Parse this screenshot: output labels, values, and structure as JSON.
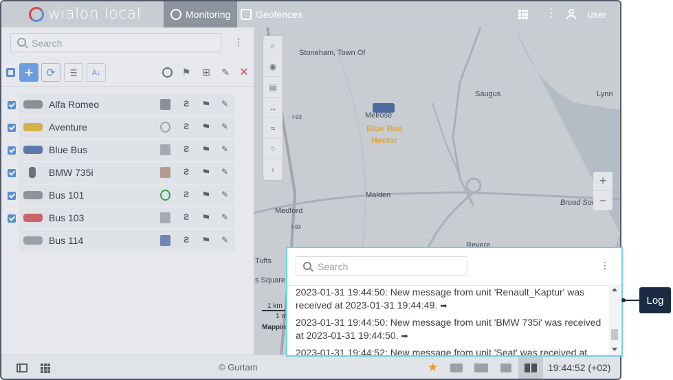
{
  "app": {
    "logo_text": "wialon local",
    "user": "user",
    "tabs": [
      {
        "label": "Monitoring",
        "active": true
      },
      {
        "label": "Geofences",
        "active": false
      }
    ]
  },
  "units_panel": {
    "search_placeholder": "Search",
    "units": [
      {
        "name": "Alfa Romeo",
        "checked": true,
        "driver": "photo"
      },
      {
        "name": "Aventure",
        "checked": true,
        "driver": "wheel"
      },
      {
        "name": "Blue Bus",
        "checked": true,
        "driver": "photo"
      },
      {
        "name": "BMW 735i",
        "checked": true,
        "driver": "photo"
      },
      {
        "name": "Bus 101",
        "checked": true,
        "driver": "wheel-green"
      },
      {
        "name": "Bus 103",
        "checked": true,
        "driver": "photo"
      },
      {
        "name": "Bus 114",
        "checked": false,
        "driver": "photo"
      }
    ]
  },
  "map": {
    "labels": [
      "Stoneham, Town Of",
      "Melrose",
      "Saugus",
      "Lynn",
      "Malden",
      "Medford",
      "Broad Sou",
      "Revere",
      "Tufts",
      "s Square",
      "I-93",
      "I-93",
      "Mapping"
    ],
    "unit_labels": [
      "Blue Bus",
      "Hector"
    ],
    "scale_km": "1 km",
    "scale_mi": "1 mi"
  },
  "log": {
    "search_placeholder": "Search",
    "entries": [
      "2023-01-31 19:44:50: New message from unit 'Renault_Kaptur' was received at 2023-01-31 19:44:49.",
      "2023-01-31 19:44:50: New message from unit 'BMW 735i' was received at 2023-01-31 19:44:50.",
      "2023-01-31 19:44:52: New message from unit 'Seat' was received at"
    ],
    "arrow": "➡"
  },
  "callout": "Log",
  "bottombar": {
    "copyright": "© Gurtam",
    "clock": "19:44:52 (+02)"
  },
  "colors": {
    "accent": "#5b8fd0",
    "log_border": "#6ed2e6",
    "callout_bg": "#1b2b44"
  }
}
